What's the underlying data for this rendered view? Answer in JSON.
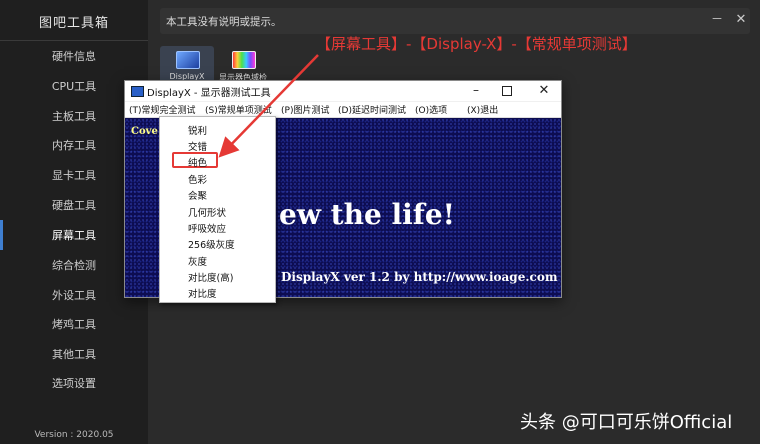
{
  "sidebar": {
    "title": "图吧工具箱",
    "items": [
      {
        "label": "硬件信息"
      },
      {
        "label": "CPU工具"
      },
      {
        "label": "主板工具"
      },
      {
        "label": "内存工具"
      },
      {
        "label": "显卡工具"
      },
      {
        "label": "硬盘工具"
      },
      {
        "label": "屏幕工具"
      },
      {
        "label": "综合检测"
      },
      {
        "label": "外设工具"
      },
      {
        "label": "烤鸡工具"
      },
      {
        "label": "其他工具"
      },
      {
        "label": "选项设置"
      }
    ],
    "active_item": "屏幕工具",
    "version": "Version : 2020.05"
  },
  "topbar": {
    "hint": "本工具没有说明或提示。",
    "minimize_glyph": "－",
    "close_glyph": "✕"
  },
  "tools": [
    {
      "label": "DisplayX",
      "icon": "monitor-icon",
      "selected": true
    },
    {
      "label": "显示器色域检",
      "icon": "rainbow-monitor-icon",
      "selected": false
    }
  ],
  "annotation": "【屏幕工具】-【Display-X】-【常规单项测试】",
  "displayx": {
    "title": "DisplayX - 显示器测试工具",
    "buttons": {
      "minimize": "–",
      "close": "✕"
    },
    "menu": [
      "(T)常规完全测试",
      "(S)常规单项测试",
      "(P)图片测试",
      "(D)延迟时间测试",
      "(O)选项",
      "(X)退出"
    ],
    "cover_text": "Cove",
    "big_text": "ew the life!",
    "footer_text": "DisplayX ver 1.2 by http://www.ioage.com"
  },
  "dropdown": {
    "items": [
      "锐利",
      "交错",
      "纯色",
      "色彩",
      "会聚",
      "几何形状",
      "呼吸效应",
      "256级灰度",
      "灰度",
      "对比度(高)",
      "对比度"
    ],
    "highlighted": "纯色"
  },
  "watermark": "头条 @可口可乐饼Official",
  "colors": {
    "annotation": "#e53935",
    "accent": "#3f7fd0",
    "canvas": "#0d0d52"
  }
}
